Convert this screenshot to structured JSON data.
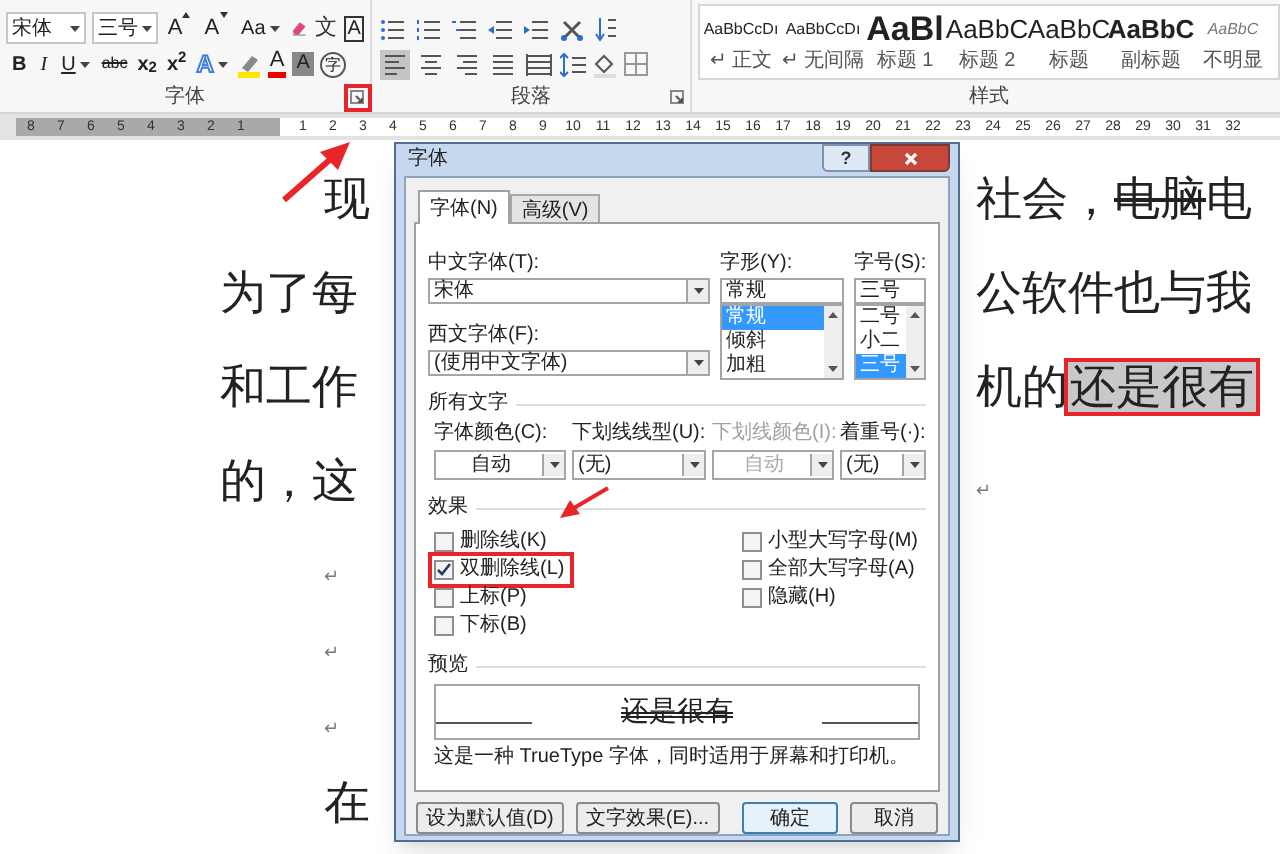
{
  "ribbon": {
    "font_name": "宋体",
    "font_size": "三号",
    "font_tools_row1": [
      {
        "kind": "grow",
        "label": "A"
      },
      {
        "kind": "shrink",
        "label": "A"
      },
      {
        "kind": "case",
        "label": "Aa"
      },
      {
        "kind": "clear"
      },
      {
        "kind": "phonetic",
        "label": "文"
      },
      {
        "kind": "border",
        "label": "A"
      }
    ],
    "font_tools_row2": [
      {
        "kind": "bold",
        "label": "B"
      },
      {
        "kind": "italic",
        "label": "I"
      },
      {
        "kind": "underline",
        "label": "U"
      },
      {
        "kind": "strike",
        "label": "abc"
      },
      {
        "kind": "script",
        "label": "x$_{2}$"
      },
      {
        "kind": "script",
        "label": "x$^{2}$"
      },
      {
        "kind": "effect",
        "label": "A"
      },
      {
        "kind": "highlight"
      },
      {
        "kind": "color",
        "label": "A"
      },
      {
        "kind": "shade",
        "label": "A"
      },
      {
        "kind": "enclose",
        "label": "字"
      }
    ],
    "alignment": [
      {
        "selected": true
      },
      {
        "selected": false
      },
      {
        "selected": false
      },
      {
        "selected": false
      },
      {
        "selected": false
      }
    ],
    "groups": [
      {
        "label": "字体",
        "launcher_highlighted": true
      },
      {
        "label": "段落",
        "launcher_highlighted": false
      },
      {
        "label": "样式"
      }
    ],
    "styles": [
      {
        "preview": "AaBbCcDı",
        "name": "↵ 正文",
        "kind": "small"
      },
      {
        "preview": "AaBbCcDı",
        "name": "↵ 无间隔",
        "kind": "small"
      },
      {
        "preview": "AaBl",
        "name": "标题 1",
        "kind": "large"
      },
      {
        "preview": "AaBbC",
        "name": "标题 2",
        "kind": "medium"
      },
      {
        "preview": "AaBbC",
        "name": "标题",
        "kind": "medium"
      },
      {
        "preview": "AaBbC",
        "name": "副标题",
        "kind": "bold"
      },
      {
        "preview": "AaBbC",
        "name": "不明显",
        "kind": "italic"
      }
    ]
  },
  "ruler": {
    "left_ticks": [
      "8",
      "7",
      "6",
      "5",
      "4",
      "3",
      "2",
      "1"
    ],
    "right_ticks": [
      "1",
      "2",
      "3",
      "4",
      "5",
      "6",
      "7",
      "8",
      "9",
      "10",
      "11",
      "12",
      "13",
      "14",
      "15",
      "16",
      "17",
      "18",
      "19",
      "20",
      "21",
      "22",
      "23",
      "24",
      "25",
      "26",
      "27",
      "28",
      "29",
      "30",
      "31",
      "32"
    ]
  },
  "document": {
    "lines": [
      {
        "indented": true,
        "left": [
          {
            "text": "现",
            "kind": "plain"
          }
        ],
        "right": [
          {
            "text": "社会，",
            "kind": "plain"
          },
          {
            "text": "电脑",
            "kind": "strike"
          },
          {
            "text": "电",
            "kind": "plain"
          }
        ]
      },
      {
        "indented": false,
        "left": [
          {
            "text": "为了每",
            "kind": "plain"
          }
        ],
        "right": [
          {
            "text": "公软件也与我",
            "kind": "plain"
          }
        ]
      },
      {
        "indented": false,
        "left": [
          {
            "text": "和工作",
            "kind": "plain"
          }
        ],
        "right": [
          {
            "text": "机的",
            "kind": "plain"
          },
          {
            "text": "还是很有",
            "kind": "highlight"
          }
        ]
      },
      {
        "indented": false,
        "left": [
          {
            "text": "的，这",
            "kind": "plain"
          }
        ],
        "right": [
          {
            "text": "↵",
            "kind": "mark"
          }
        ]
      },
      {
        "indented": true,
        "left": [
          {
            "text": "↵",
            "kind": "mark"
          }
        ]
      },
      {
        "indented": true,
        "left": [
          {
            "text": "↵",
            "kind": "mark"
          }
        ]
      },
      {
        "indented": true,
        "left": [
          {
            "text": "↵",
            "kind": "mark"
          }
        ]
      },
      {
        "indented": true,
        "left": [
          {
            "text": "在",
            "kind": "plain"
          }
        ]
      }
    ]
  },
  "dialog": {
    "title": "字体",
    "help": "?",
    "tabs": [
      {
        "label": "字体(N)",
        "selected": true
      },
      {
        "label": "高级(V)",
        "selected": false
      }
    ],
    "chinese_font": {
      "label": "中文字体(T):",
      "value": "宋体"
    },
    "western_font": {
      "label": "西文字体(F):",
      "value": "(使用中文字体)"
    },
    "font_style": {
      "label": "字形(Y):",
      "value": "常规",
      "options": [
        {
          "label": "常规",
          "selected": true
        },
        {
          "label": "倾斜",
          "selected": false
        },
        {
          "label": "加粗",
          "selected": false
        }
      ]
    },
    "font_size": {
      "label": "字号(S):",
      "value": "三号",
      "options": [
        {
          "label": "二号",
          "selected": false
        },
        {
          "label": "小二",
          "selected": false
        },
        {
          "label": "三号",
          "selected": true
        }
      ]
    },
    "all_text": {
      "heading": "所有文字",
      "fields": [
        {
          "label": "字体颜色(C):",
          "value": "自动",
          "kind": "color",
          "disabled": false
        },
        {
          "label": "下划线线型(U):",
          "value": "(无)",
          "kind": "list",
          "disabled": false
        },
        {
          "label": "下划线颜色(I):",
          "value": "自动",
          "kind": "color",
          "disabled": true
        },
        {
          "label": "着重号(·):",
          "value": "(无)",
          "kind": "list",
          "disabled": false
        }
      ]
    },
    "effects": {
      "heading": "效果",
      "left": [
        {
          "label": "删除线(K)",
          "checked": false,
          "highlighted": false
        },
        {
          "label": "双删除线(L)",
          "checked": true,
          "highlighted": true
        },
        {
          "label": "上标(P)",
          "checked": false,
          "highlighted": false
        },
        {
          "label": "下标(B)",
          "checked": false,
          "highlighted": false
        }
      ],
      "right": [
        {
          "label": "小型大写字母(M)",
          "checked": false,
          "highlighted": false
        },
        {
          "label": "全部大写字母(A)",
          "checked": false,
          "highlighted": false
        },
        {
          "label": "隐藏(H)",
          "checked": false,
          "highlighted": false
        }
      ]
    },
    "preview": {
      "heading": "预览",
      "sample": "还是很有",
      "note": "这是一种 TrueType 字体，同时适用于屏幕和打印机。"
    },
    "buttons": [
      {
        "label": "设为默认值(D)",
        "kind": "normal"
      },
      {
        "label": "文字效果(E)...",
        "kind": "normal"
      },
      {
        "label": "确定",
        "kind": "default"
      },
      {
        "label": "取消",
        "kind": "normal"
      }
    ]
  }
}
